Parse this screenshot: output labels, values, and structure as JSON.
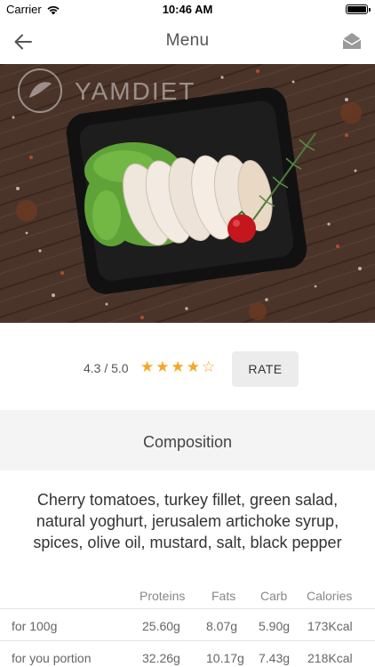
{
  "status_bar": {
    "carrier": "Carrier",
    "time": "10:46 AM"
  },
  "nav": {
    "title": "Menu"
  },
  "hero": {
    "watermark": "YAMDIET"
  },
  "rating": {
    "score_text": "4.3 / 5.0",
    "value": 4.3,
    "max": 5,
    "rate_label": "RATE"
  },
  "composition": {
    "header": "Composition",
    "ingredients": "Cherry tomatoes, turkey fillet, green salad, natural yoghurt, jerusalem artichoke syrup, spices, olive oil, mustard, salt, black pepper"
  },
  "nutrition": {
    "headers": [
      "",
      "Proteins",
      "Fats",
      "Carb",
      "Calories"
    ],
    "rows": [
      [
        "for 100g",
        "25.60g",
        "8.07g",
        "5.90g",
        "173Kcal"
      ],
      [
        "for you portion",
        "32.26g",
        "10.17g",
        "7.43g",
        "218Kcal"
      ]
    ]
  },
  "colors": {
    "star": "#f5a623",
    "accent_bg": "#f4f4f4",
    "button_bg": "#ececec"
  }
}
